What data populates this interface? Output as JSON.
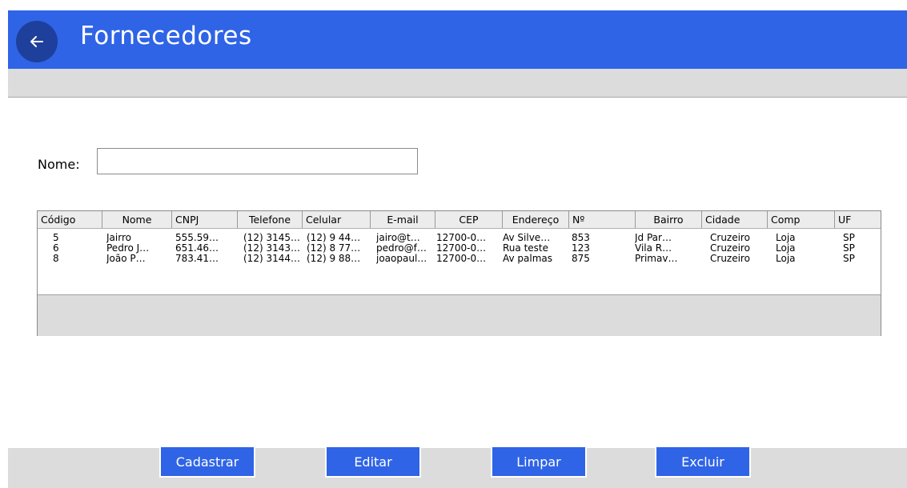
{
  "header": {
    "title": "Fornecedores"
  },
  "form": {
    "name_label": "Nome:",
    "name_value": "",
    "name_placeholder": ""
  },
  "table": {
    "columns": [
      "Código",
      "Nome",
      "CNPJ",
      "Telefone",
      "Celular",
      "E-mail",
      "CEP",
      "Endereço",
      "Nº",
      "Bairro",
      "Cidade",
      "Comp",
      "UF"
    ],
    "rows": [
      [
        "5",
        "Jairro",
        "555.59…",
        "(12) 3145…",
        "(12) 9 44…",
        "jairo@t…",
        "12700-0…",
        "Av Silve…",
        "853",
        "Jd Par…",
        "Cruzeiro",
        "Loja",
        "SP"
      ],
      [
        "6",
        "Pedro J…",
        "651.46…",
        "(12) 3143…",
        "(12) 8 77…",
        "pedro@f…",
        "12700-0…",
        "Rua teste",
        "123",
        "Vila R…",
        "Cruzeiro",
        "Loja",
        "SP"
      ],
      [
        "8",
        "João P…",
        "783.41…",
        "(12) 3144…",
        "(12) 9 88…",
        "joaopaul…",
        "12700-0…",
        "Av palmas",
        "875",
        "Primav…",
        "Cruzeiro",
        "Loja",
        "SP"
      ]
    ]
  },
  "actions": {
    "cadastrar": "Cadastrar",
    "editar": "Editar",
    "limpar": "Limpar",
    "excluir": "Excluir"
  },
  "colors": {
    "primary": "#2f64e6",
    "back_circle": "#1f3f9c",
    "panel_gray": "#dcdcdc"
  }
}
